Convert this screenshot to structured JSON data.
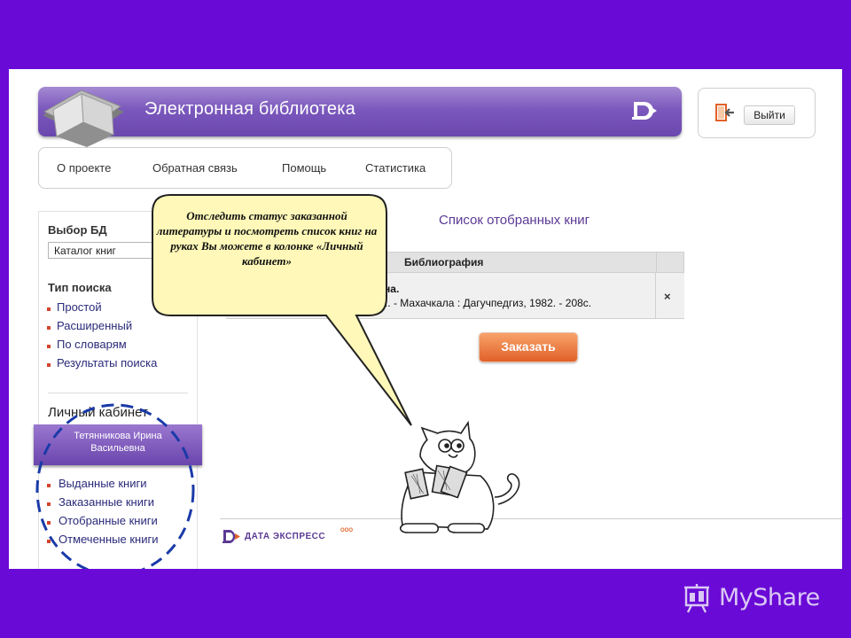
{
  "header": {
    "title": "Электронная библиотека",
    "logout_label": "Выйти"
  },
  "nav": {
    "items": [
      "О проекте",
      "Обратная связь",
      "Помощь",
      "Статистика"
    ]
  },
  "sidebar": {
    "db_heading": "Выбор БД",
    "db_selected": "Каталог книг",
    "search_heading": "Тип поиска",
    "search_items": [
      "Простой",
      "Расширенный",
      "По словарям",
      "Результаты поиска"
    ],
    "cabinet_heading": "Личный кабинет",
    "user_name_line1": "Тетянникова Ирина",
    "user_name_line2": "Васильевна",
    "cabinet_items": [
      "Выданные книги",
      "Заказанные книги",
      "Отобранные книги",
      "Отмеченные книги"
    ]
  },
  "main": {
    "list_title": "Список отобранных книг",
    "column_header": "Библиография",
    "rows": [
      {
        "author_fragment": "асовна.",
        "description_fragment": "е изд.. - Махачкала : Дагучпедгиз, 1982. - 208с.",
        "remove_label": "×"
      }
    ],
    "order_label": "Заказать"
  },
  "footer": {
    "logo_text": "ДАТА ЭКСПРЕСС",
    "logo_suffix": "ООО"
  },
  "callout": {
    "text": "Отследить статус заказанной литературы и посмотреть список книг на руках Вы можете в колонке «Личный кабинет»"
  },
  "watermark": {
    "text": "MyShare"
  },
  "colors": {
    "slide_background": "#6a0ad6",
    "header_purple": "#7b58bd",
    "accent_orange": "#e06128",
    "callout_fill": "#fff8b8",
    "dash_blue": "#1a3aa8"
  }
}
